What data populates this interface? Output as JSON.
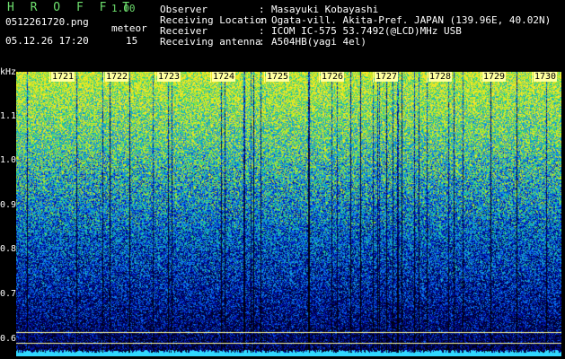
{
  "header": {
    "app_title": "H R O F F T",
    "version": "1.00",
    "filename": "0512261720.png",
    "datetime": "05.12.26 17:20",
    "meteor_label": "meteor",
    "meteor_count": "15"
  },
  "info": [
    {
      "key": "Observer",
      "value": "Masayuki Kobayashi"
    },
    {
      "key": "Receiving Location",
      "value": "Ogata-vill. Akita-Pref. JAPAN (139.96E, 40.02N)"
    },
    {
      "key": "Receiver",
      "value": "ICOM IC-575 53.7492(@LCD)MHz USB"
    },
    {
      "key": "Receiving antenna",
      "value": "A504HB(yagi 4el)"
    }
  ],
  "axis": {
    "unit": "kHz",
    "ticks": [
      "1.1",
      "1.0",
      "0.9",
      "0.8",
      "0.7",
      "0.6"
    ]
  },
  "time_labels": [
    "1721",
    "1722",
    "1723",
    "1724",
    "1725",
    "1726",
    "1727",
    "1728",
    "1729",
    "1730"
  ],
  "colors": {
    "title": "#6ee06e",
    "label_bg": "#ffffa0",
    "low": "#000060",
    "mid": "#1a6cff",
    "high": "#c8ff30",
    "baseline": "#30d8ff"
  }
}
